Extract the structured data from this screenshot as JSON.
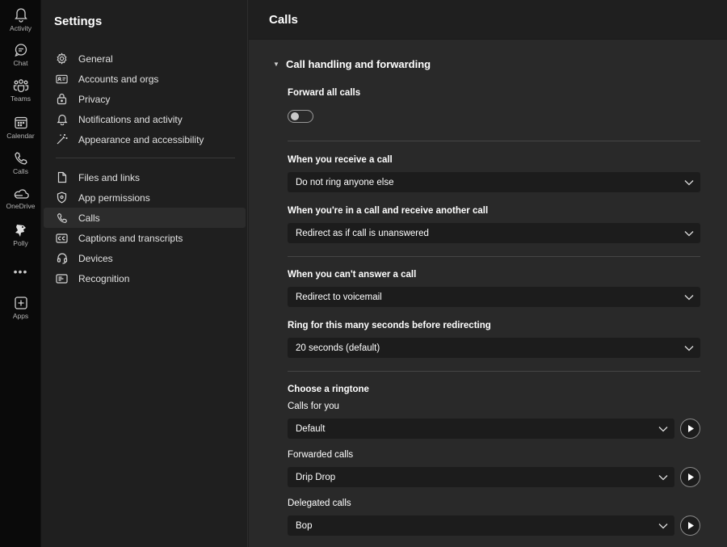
{
  "rail": {
    "items": [
      {
        "label": "Activity",
        "icon": "bell-icon"
      },
      {
        "label": "Chat",
        "icon": "chat-icon"
      },
      {
        "label": "Teams",
        "icon": "teams-icon"
      },
      {
        "label": "Calendar",
        "icon": "calendar-icon"
      },
      {
        "label": "Calls",
        "icon": "phone-icon"
      },
      {
        "label": "OneDrive",
        "icon": "cloud-icon"
      },
      {
        "label": "Polly",
        "icon": "polly-icon"
      },
      {
        "label": "Apps",
        "icon": "plus-square-icon"
      }
    ],
    "more": "•••"
  },
  "sidebar": {
    "title": "Settings",
    "items": [
      {
        "label": "General",
        "icon": "gear-icon"
      },
      {
        "label": "Accounts and orgs",
        "icon": "id-card-icon"
      },
      {
        "label": "Privacy",
        "icon": "lock-icon"
      },
      {
        "label": "Notifications and activity",
        "icon": "bell-icon"
      },
      {
        "label": "Appearance and accessibility",
        "icon": "wand-icon"
      },
      {
        "label": "Files and links",
        "icon": "file-icon"
      },
      {
        "label": "App permissions",
        "icon": "shield-icon"
      },
      {
        "label": "Calls",
        "icon": "phone-icon",
        "active": true
      },
      {
        "label": "Captions and transcripts",
        "icon": "cc-icon"
      },
      {
        "label": "Devices",
        "icon": "headset-icon"
      },
      {
        "label": "Recognition",
        "icon": "recognition-icon"
      }
    ]
  },
  "main": {
    "title": "Calls",
    "section_title": "Call handling and forwarding",
    "forward_all_label": "Forward all calls",
    "forward_all_on": false,
    "receive_label": "When you receive a call",
    "receive_value": "Do not ring anyone else",
    "in_call_label": "When you're in a call and receive another call",
    "in_call_value": "Redirect as if call is unanswered",
    "cant_answer_label": "When you can't answer a call",
    "cant_answer_value": "Redirect to voicemail",
    "ring_seconds_label": "Ring for this many seconds before redirecting",
    "ring_seconds_value": "20 seconds (default)",
    "ringtone_title": "Choose a ringtone",
    "ringtones": [
      {
        "label": "Calls for you",
        "value": "Default"
      },
      {
        "label": "Forwarded calls",
        "value": "Drip Drop"
      },
      {
        "label": "Delegated calls",
        "value": "Bop"
      }
    ]
  },
  "colors": {
    "rail_bg": "#0a0a0a",
    "sidebar_bg": "#1f1f1f",
    "main_bg": "#292929",
    "field_bg": "#1c1c1c",
    "active_item_bg": "#2c2c2c"
  }
}
